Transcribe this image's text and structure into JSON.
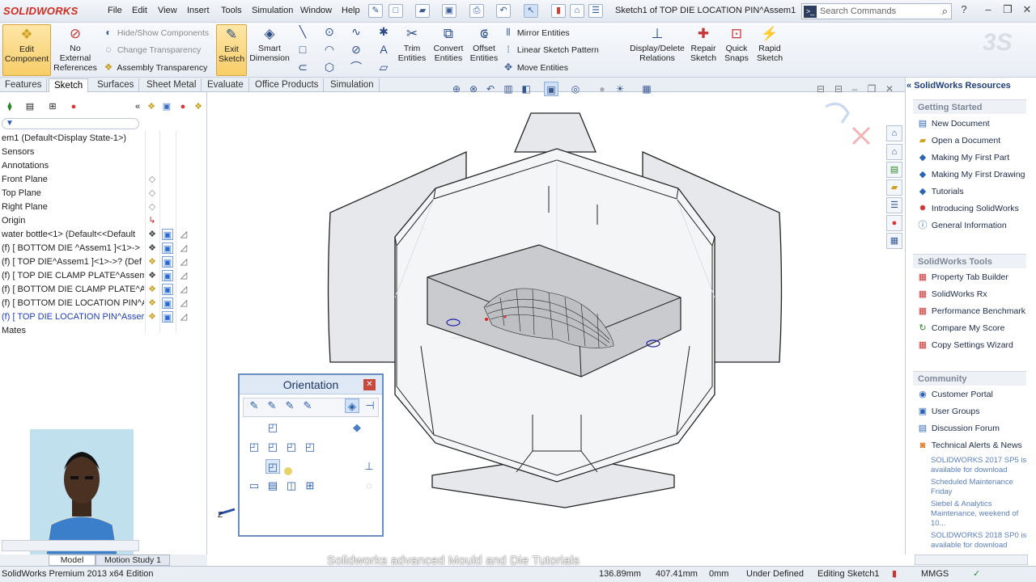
{
  "app": {
    "logo": "SOLIDWORKS",
    "doc_title": "Sketch1 of TOP DIE LOCATION PIN^Assem1 -i...",
    "search_placeholder": "Search Commands"
  },
  "menu": [
    "File",
    "Edit",
    "View",
    "Insert",
    "Tools",
    "Simulation",
    "Window",
    "Help"
  ],
  "ribbon": {
    "edit_component": "Edit Component",
    "no_external": "No External References",
    "hide_show": "Hide/Show Components",
    "change_transparency": "Change Transparency",
    "assembly_transparency": "Assembly Transparency",
    "exit_sketch": "Exit Sketch",
    "smart_dimension": "Smart Dimension",
    "trim_entities": "Trim Entities",
    "convert_entities": "Convert Entities",
    "offset_entities": "Offset Entities",
    "mirror_entities": "Mirror Entities",
    "linear_pattern": "Linear Sketch Pattern",
    "move_entities": "Move Entities",
    "display_delete": "Display/Delete Relations",
    "repair_sketch": "Repair Sketch",
    "quick_snaps": "Quick Snaps",
    "rapid_sketch": "Rapid Sketch"
  },
  "tabs": [
    "Features",
    "Sketch",
    "Surfaces",
    "Sheet Metal",
    "Evaluate",
    "Office Products",
    "Simulation"
  ],
  "active_tab": "Sketch",
  "tree": [
    {
      "label": "em1  (Default<Display State-1>)",
      "blue": false
    },
    {
      "label": "Sensors",
      "blue": false
    },
    {
      "label": "Annotations",
      "blue": false
    },
    {
      "label": "Front Plane",
      "blue": false
    },
    {
      "label": "Top Plane",
      "blue": false
    },
    {
      "label": "Right Plane",
      "blue": false
    },
    {
      "label": "Origin",
      "blue": false
    },
    {
      "label": "water bottle<1> (Default<<Default",
      "blue": false
    },
    {
      "label": "(f) [ BOTTOM DIE ^Assem1 ]<1>->",
      "blue": false
    },
    {
      "label": "(f) [ TOP DIE^Assem1 ]<1>->? (Def",
      "blue": false
    },
    {
      "label": "(f) [ TOP DIE CLAMP PLATE^Assem",
      "blue": false
    },
    {
      "label": "(f) [ BOTTOM DIE CLAMP PLATE^A",
      "blue": false
    },
    {
      "label": "(f) [ BOTTOM DIE LOCATION PIN^A",
      "blue": false
    },
    {
      "label": "(f) [ TOP DIE LOCATION PIN^Asser",
      "blue": true
    },
    {
      "label": "Mates",
      "blue": false
    }
  ],
  "orientation": {
    "title": "Orientation"
  },
  "resources": {
    "title": "SolidWorks Resources",
    "getting_started": {
      "heading": "Getting Started",
      "items": [
        "New Document",
        "Open a Document",
        "Making My First Part",
        "Making My First Drawing",
        "Tutorials",
        "Introducing SolidWorks",
        "General Information"
      ]
    },
    "tools": {
      "heading": "SolidWorks Tools",
      "items": [
        "Property Tab Builder",
        "SolidWorks Rx",
        "Performance Benchmark",
        "Compare My Score",
        "Copy Settings Wizard"
      ]
    },
    "community": {
      "heading": "Community",
      "items": [
        "Customer Portal",
        "User Groups",
        "Discussion Forum",
        "Technical Alerts & News"
      ]
    },
    "news": [
      "SOLIDWORKS 2017 SP5 is available for download",
      "Scheduled Maintenance Friday",
      "Siebel & Analytics Maintenance, weekend of 10...",
      "SOLIDWORKS 2018 SP0 is available for download"
    ]
  },
  "bottom_tabs": [
    "Model",
    "Motion Study 1"
  ],
  "status": {
    "edition": "SolidWorks Premium 2013 x64 Edition",
    "x": "136.89mm",
    "y": "407.41mm",
    "z": "0mm",
    "defined": "Under Defined",
    "mode": "Editing Sketch1",
    "units": "MMGS"
  },
  "watermark": "Solidworks advanced Mould and Die Tutorials"
}
